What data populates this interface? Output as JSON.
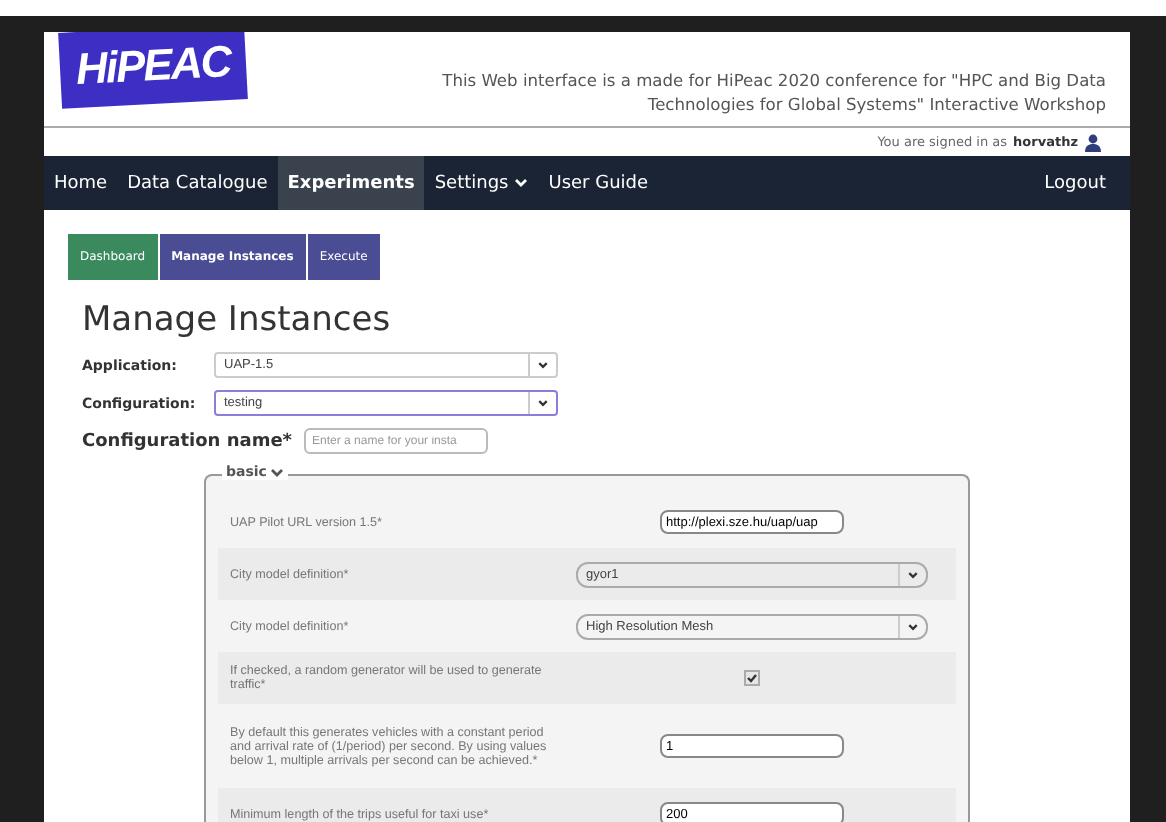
{
  "logo": {
    "text": "HiPEAC"
  },
  "header": {
    "tagline": "This Web interface is a made for HiPeac 2020 conference for \"HPC and Big Data Technologies for Global Systems\" Interactive Workshop",
    "signed_in_text": "You are signed in as",
    "username": "horvathz"
  },
  "nav": {
    "items": [
      {
        "label": "Home",
        "selected": false,
        "dropdown": false
      },
      {
        "label": "Data Catalogue",
        "selected": false,
        "dropdown": false
      },
      {
        "label": "Experiments",
        "selected": true,
        "dropdown": false
      },
      {
        "label": "Settings",
        "selected": false,
        "dropdown": true
      },
      {
        "label": "User Guide",
        "selected": false,
        "dropdown": false
      }
    ],
    "logout": "Logout"
  },
  "tabs": [
    {
      "label": "Dashboard",
      "selected": false,
      "color": "#3a8a5e"
    },
    {
      "label": "Manage Instances",
      "selected": true,
      "color": "#4a4c94"
    },
    {
      "label": "Execute",
      "selected": false,
      "color": "#4a4c94"
    }
  ],
  "page_title": "Manage Instances",
  "selectors": [
    {
      "label": "Application:",
      "value": "UAP-1.5",
      "focused": false
    },
    {
      "label": "Configuration:",
      "value": "testing",
      "focused": true
    }
  ],
  "config_name": {
    "label": "Configuration name*",
    "placeholder": "Enter a name for your insta"
  },
  "fieldset": {
    "legend": "basic",
    "expanded": true,
    "rows": [
      {
        "kind": "text",
        "label": "UAP Pilot URL version 1.5*",
        "value": "http://plexi.sze.hu/uap/uap"
      },
      {
        "kind": "select",
        "label": "City model definition*",
        "value": "gyor1"
      },
      {
        "kind": "select",
        "label": "City model definition*",
        "value": "High Resolution Mesh"
      },
      {
        "kind": "checkbox",
        "label": "If checked, a random generator will be used to generate traffic*",
        "checked": true
      },
      {
        "kind": "text",
        "label": "By default this generates vehicles with a constant period and arrival rate of (1/period) per second. By using values below 1, multiple arrivals per second can be achieved.*",
        "value": "1"
      },
      {
        "kind": "text",
        "label": "Minimum length of the trips useful for taxi use*",
        "value": "200"
      }
    ]
  }
}
